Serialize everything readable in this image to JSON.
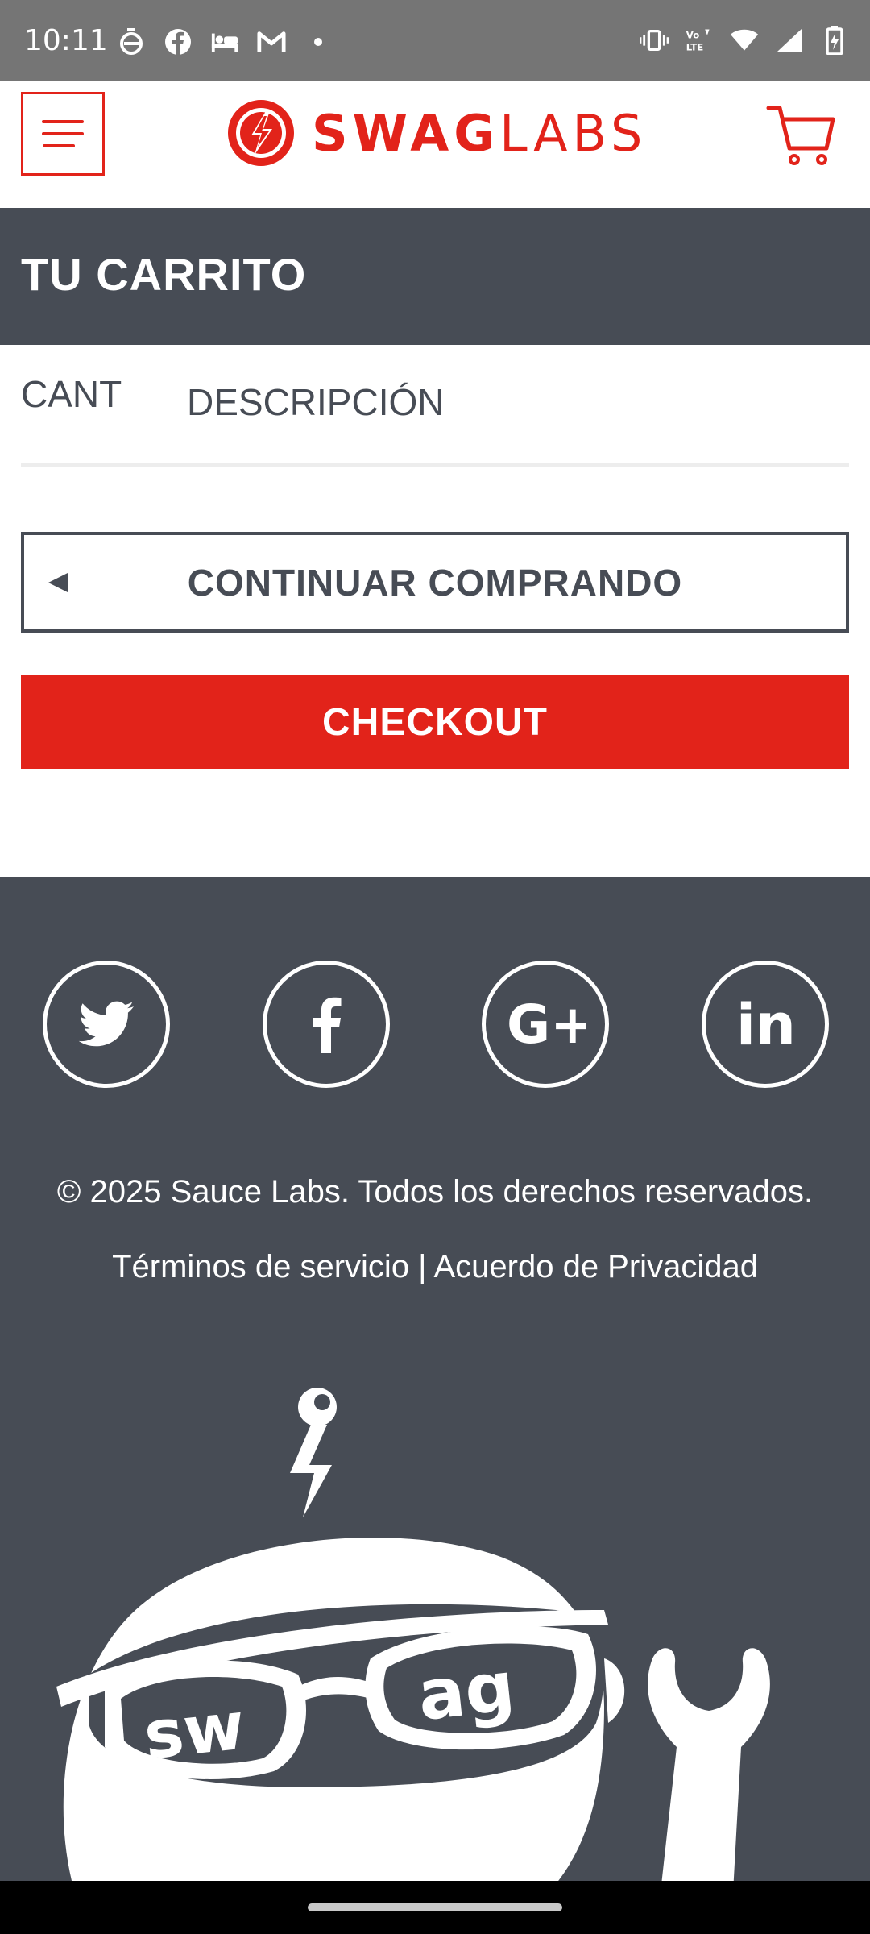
{
  "status_bar": {
    "time": "10:11",
    "left_icons": [
      "stopwatch-icon",
      "facebook-icon",
      "bed-icon",
      "gmail-icon",
      "dot-icon"
    ],
    "right_icons": [
      "vibrate-icon",
      "volte-icon",
      "wifi-icon",
      "signal-icon",
      "battery-charging-icon"
    ],
    "volte_label": "Vo LTE"
  },
  "header": {
    "brand_bold": "SWAG",
    "brand_light": "LABS",
    "brand_color": "#e2231a"
  },
  "page": {
    "title": "TU CARRITO",
    "band_color": "#474c55"
  },
  "cart_table": {
    "qty_header": "CANT",
    "desc_header": "DESCRIPCIÓN",
    "items": []
  },
  "actions": {
    "continue_label": "CONTINUAR COMPRANDO",
    "checkout_label": "CHECKOUT"
  },
  "footer": {
    "social": [
      "twitter-icon",
      "facebook-icon",
      "google-plus-icon",
      "linkedin-icon"
    ],
    "social_labels": {
      "google": "G+",
      "linkedin": "in"
    },
    "copyright": "© 2025 Sauce Labs. Todos los derechos reservados.",
    "legal": "Términos de servicio | Acuerdo de Privacidad",
    "mascot_text_left": "sw",
    "mascot_text_right": "ag"
  }
}
